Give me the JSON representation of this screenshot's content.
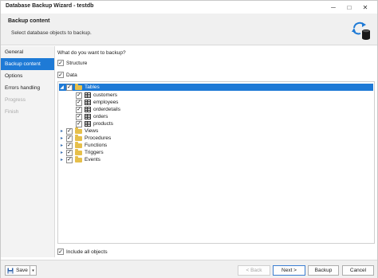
{
  "window": {
    "title": "Database Backup Wizard - testdb"
  },
  "header": {
    "title": "Backup content",
    "subtitle": "Select database objects to backup."
  },
  "sidebar": {
    "items": [
      {
        "label": "General",
        "state": "normal"
      },
      {
        "label": "Backup content",
        "state": "active"
      },
      {
        "label": "Options",
        "state": "normal"
      },
      {
        "label": "Errors handling",
        "state": "normal"
      },
      {
        "label": "Progress",
        "state": "disabled"
      },
      {
        "label": "Finish",
        "state": "disabled"
      }
    ]
  },
  "main": {
    "question": "What do you want to backup?",
    "structure_label": "Structure",
    "structure_checked": true,
    "data_label": "Data",
    "data_checked": true,
    "include_all_label": "Include all objects",
    "include_all_checked": true
  },
  "tree": {
    "tables_label": "Tables",
    "tables": [
      "customers",
      "employees",
      "orderdetails",
      "orders",
      "products"
    ],
    "folders": [
      "Views",
      "Procedures",
      "Functions",
      "Triggers",
      "Events"
    ]
  },
  "footer": {
    "save": "Save",
    "back": "< Back",
    "next": "Next >",
    "backup": "Backup",
    "cancel": "Cancel"
  },
  "colors": {
    "accent": "#1e7ad6",
    "folder": "#e6bf4a"
  }
}
